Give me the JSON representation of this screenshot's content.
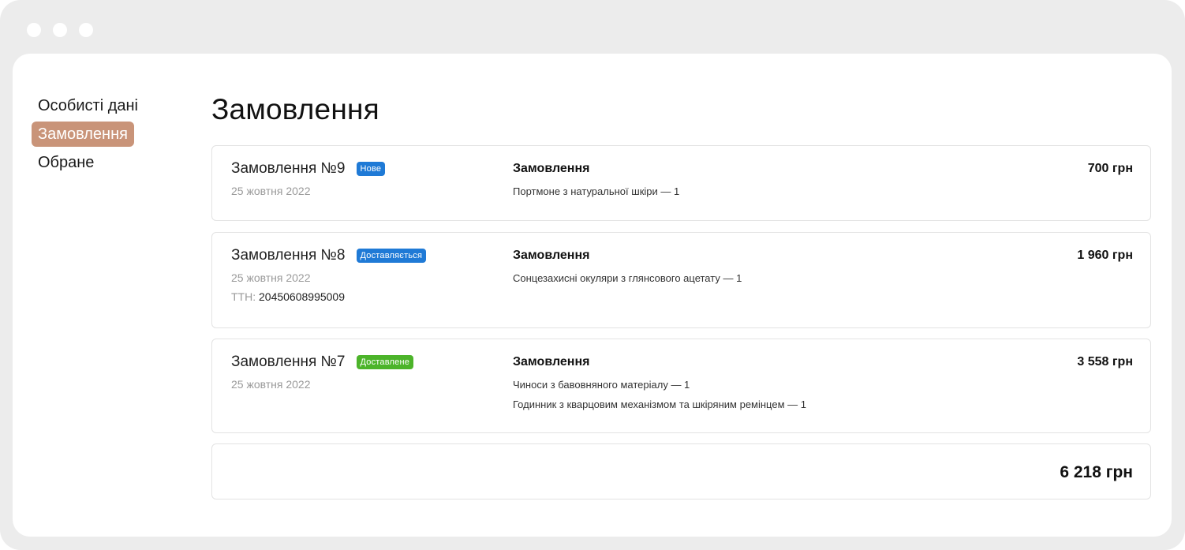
{
  "sidebar": {
    "items": [
      {
        "label": "Особисті дані",
        "active": false
      },
      {
        "label": "Замовлення",
        "active": true
      },
      {
        "label": "Обране",
        "active": false
      }
    ]
  },
  "main": {
    "title": "Замовлення",
    "orders": [
      {
        "title": "Замовлення №9",
        "badge": "Нове",
        "badge_color": "#1f7ad6",
        "date": "25 жовтня 2022",
        "items_heading": "Замовлення",
        "items": [
          "Портмоне з натуральної шкіри — 1"
        ],
        "price": "700 грн"
      },
      {
        "title": "Замовлення №8",
        "badge": "Доставляється",
        "badge_color": "#1f7ad6",
        "date": "25 жовтня 2022",
        "ttn_label": "ТТН:",
        "ttn_value": "20450608995009",
        "items_heading": "Замовлення",
        "items": [
          "Сонцезахисні окуляри з глянсового ацетату — 1"
        ],
        "price": "1 960 грн"
      },
      {
        "title": "Замовлення №7",
        "badge": "Доставлене",
        "badge_color": "#4cb42a",
        "date": "25 жовтня 2022",
        "items_heading": "Замовлення",
        "items": [
          "Чиноси з бавовняного матеріалу — 1",
          "Годинник з кварцовим механізмом та шкіряним ремінцем — 1"
        ],
        "price": "3 558 грн"
      }
    ],
    "total": "6 218 грн"
  },
  "colors": {
    "accent": "#c99479",
    "window_bg": "#ececec",
    "border": "#e3e3e3"
  }
}
